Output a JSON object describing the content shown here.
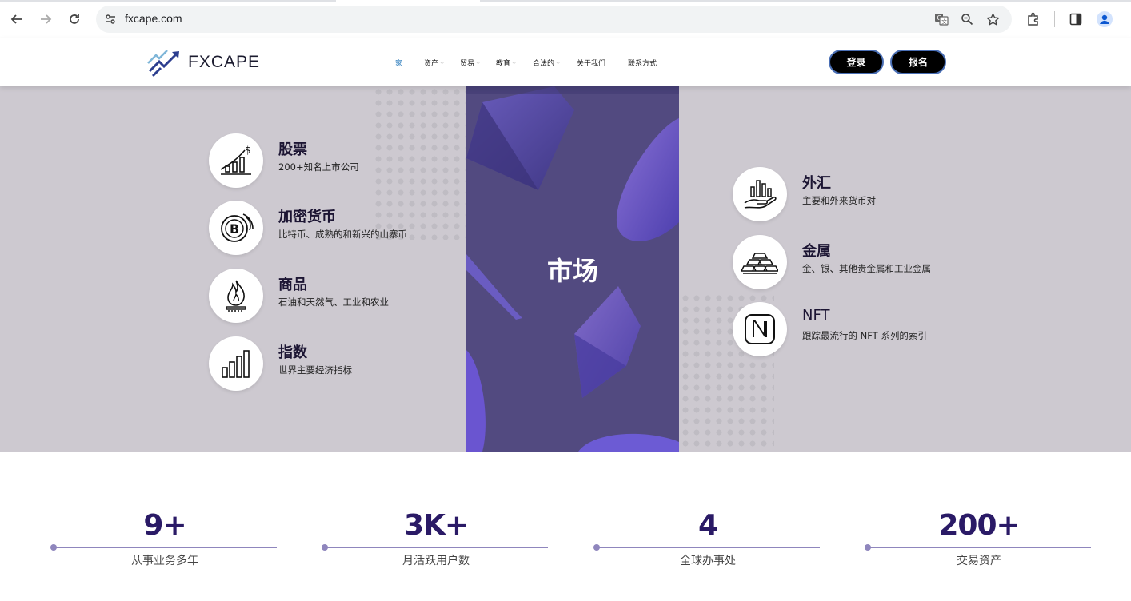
{
  "browser": {
    "url": "fxcape.com"
  },
  "site": {
    "logo_text": "FXCAPE",
    "nav": [
      {
        "label": "家",
        "color": "#2e7dbd"
      },
      {
        "label": "资产"
      },
      {
        "label": "贸易"
      },
      {
        "label": "教育"
      },
      {
        "label": "合法的"
      },
      {
        "label": "关于我们"
      },
      {
        "label": "联系方式"
      }
    ],
    "login_label": "登录",
    "signup_label": "报名"
  },
  "markets": {
    "center_title": "市场",
    "left": [
      {
        "title": "股票",
        "desc": "200+知名上市公司",
        "icon": "stock-chart-icon"
      },
      {
        "title": "加密货币",
        "desc": "比特币、成熟的和新兴的山寨币",
        "icon": "bitcoin-icon"
      },
      {
        "title": "商品",
        "desc": "石油和天然气、工业和农业",
        "icon": "flame-icon"
      },
      {
        "title": "指数",
        "desc": "世界主要经济指标",
        "icon": "bar-chart-icon"
      }
    ],
    "right": [
      {
        "title": "外汇",
        "desc": "主要和外来货币对",
        "icon": "hand-chart-icon"
      },
      {
        "title": "金属",
        "desc": "金、银、其他贵金属和工业金属",
        "icon": "gold-bars-icon"
      },
      {
        "title": "NFT",
        "desc": "跟踪最流行的 NFT 系列的索引",
        "icon": "nft-icon"
      }
    ]
  },
  "stats": [
    {
      "num": "9+",
      "label": "从事业务多年"
    },
    {
      "num": "3K+",
      "label": "月活跃用户数"
    },
    {
      "num": "4",
      "label": "全球办事处"
    },
    {
      "num": "200+",
      "label": "交易资产"
    }
  ]
}
